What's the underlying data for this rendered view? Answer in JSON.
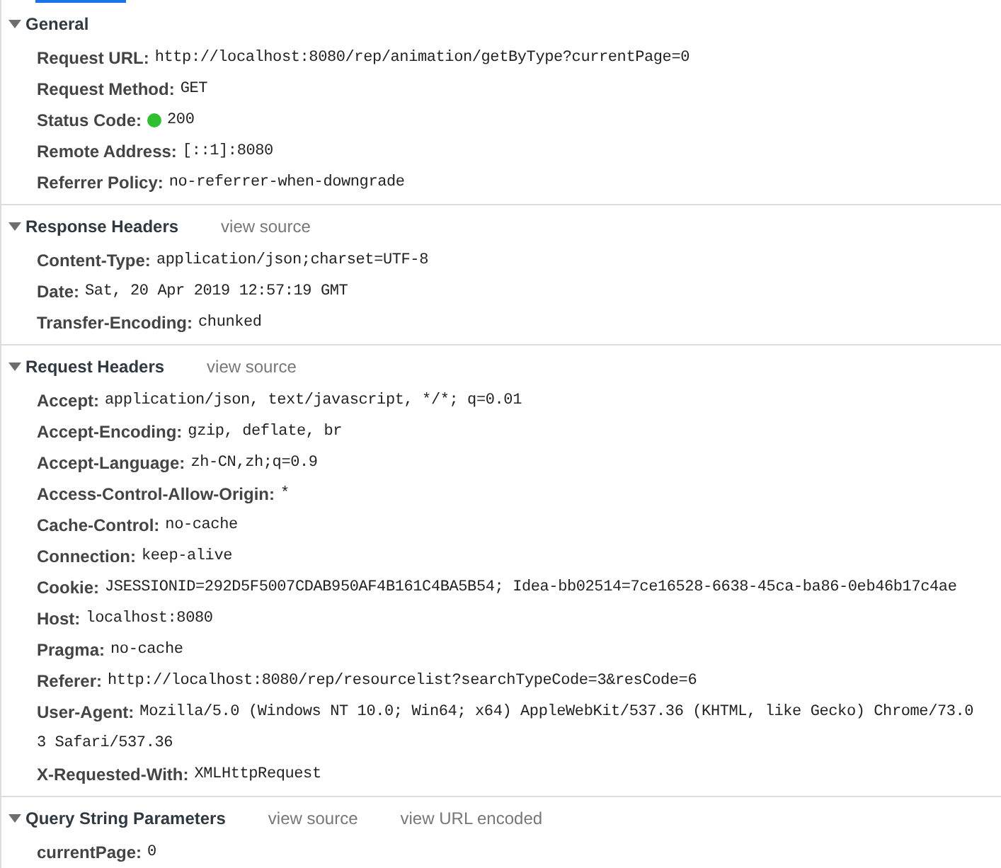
{
  "sections": [
    {
      "title": "General",
      "expanded": true,
      "rows": [
        {
          "kind": "plain",
          "name": "Request URL:",
          "value_lines": [
            "http://localhost:8080/rep/animation/getByType?currentPage=0"
          ]
        },
        {
          "kind": "plain",
          "name": "Request Method:",
          "value_lines": [
            "GET"
          ]
        },
        {
          "kind": "status",
          "name": "Status Code:",
          "color": "#2fbf2f",
          "value_lines": [
            "200"
          ]
        },
        {
          "kind": "plain",
          "name": "Remote Address:",
          "value_lines": [
            "[::1]:8080"
          ]
        },
        {
          "kind": "plain",
          "name": "Referrer Policy:",
          "value_lines": [
            "no-referrer-when-downgrade"
          ]
        }
      ]
    },
    {
      "title": "Response Headers",
      "expanded": true,
      "links": [
        "view source"
      ],
      "rows": [
        {
          "kind": "plain",
          "name": "Content-Type:",
          "value_lines": [
            "application/json;charset=UTF-8"
          ]
        },
        {
          "kind": "plain",
          "name": "Date:",
          "value_lines": [
            "Sat, 20 Apr 2019 12:57:19 GMT"
          ]
        },
        {
          "kind": "plain",
          "name": "Transfer-Encoding:",
          "value_lines": [
            "chunked"
          ]
        }
      ]
    },
    {
      "title": "Request Headers",
      "expanded": true,
      "links": [
        "view source"
      ],
      "rows": [
        {
          "kind": "plain",
          "name": "Accept:",
          "value_lines": [
            "application/json, text/javascript, */*; q=0.01"
          ]
        },
        {
          "kind": "plain",
          "name": "Accept-Encoding:",
          "value_lines": [
            "gzip, deflate, br"
          ]
        },
        {
          "kind": "plain",
          "name": "Accept-Language:",
          "value_lines": [
            "zh-CN,zh;q=0.9"
          ]
        },
        {
          "kind": "plain",
          "name": "Access-Control-Allow-Origin:",
          "value_lines": [
            "*"
          ]
        },
        {
          "kind": "plain",
          "name": "Cache-Control:",
          "value_lines": [
            "no-cache"
          ]
        },
        {
          "kind": "plain",
          "name": "Connection:",
          "value_lines": [
            "keep-alive"
          ]
        },
        {
          "kind": "plain",
          "name": "Cookie:",
          "value_lines": [
            "JSESSIONID=292D5F5007CDAB950AF4B161C4BA5B54; Idea-bb02514=7ce16528-6638-45ca-ba86-0eb46b17c4ae"
          ]
        },
        {
          "kind": "plain",
          "name": "Host:",
          "value_lines": [
            "localhost:8080"
          ]
        },
        {
          "kind": "plain",
          "name": "Pragma:",
          "value_lines": [
            "no-cache"
          ]
        },
        {
          "kind": "plain",
          "name": "Referer:",
          "value_lines": [
            "http://localhost:8080/rep/resourcelist?searchTypeCode=3&resCode=6"
          ]
        },
        {
          "kind": "plain",
          "name": "User-Agent:",
          "value_lines": [
            "Mozilla/5.0 (Windows NT 10.0; Win64; x64) AppleWebKit/537.36 (KHTML, like Gecko) Chrome/73.0",
            "3 Safari/537.36"
          ]
        },
        {
          "kind": "plain",
          "name": "X-Requested-With:",
          "value_lines": [
            "XMLHttpRequest"
          ]
        }
      ]
    },
    {
      "title": "Query String Parameters",
      "expanded": true,
      "links": [
        "view source",
        "view URL encoded"
      ],
      "rows": [
        {
          "kind": "plain",
          "name": "currentPage:",
          "value_lines": [
            "0"
          ]
        }
      ]
    }
  ]
}
